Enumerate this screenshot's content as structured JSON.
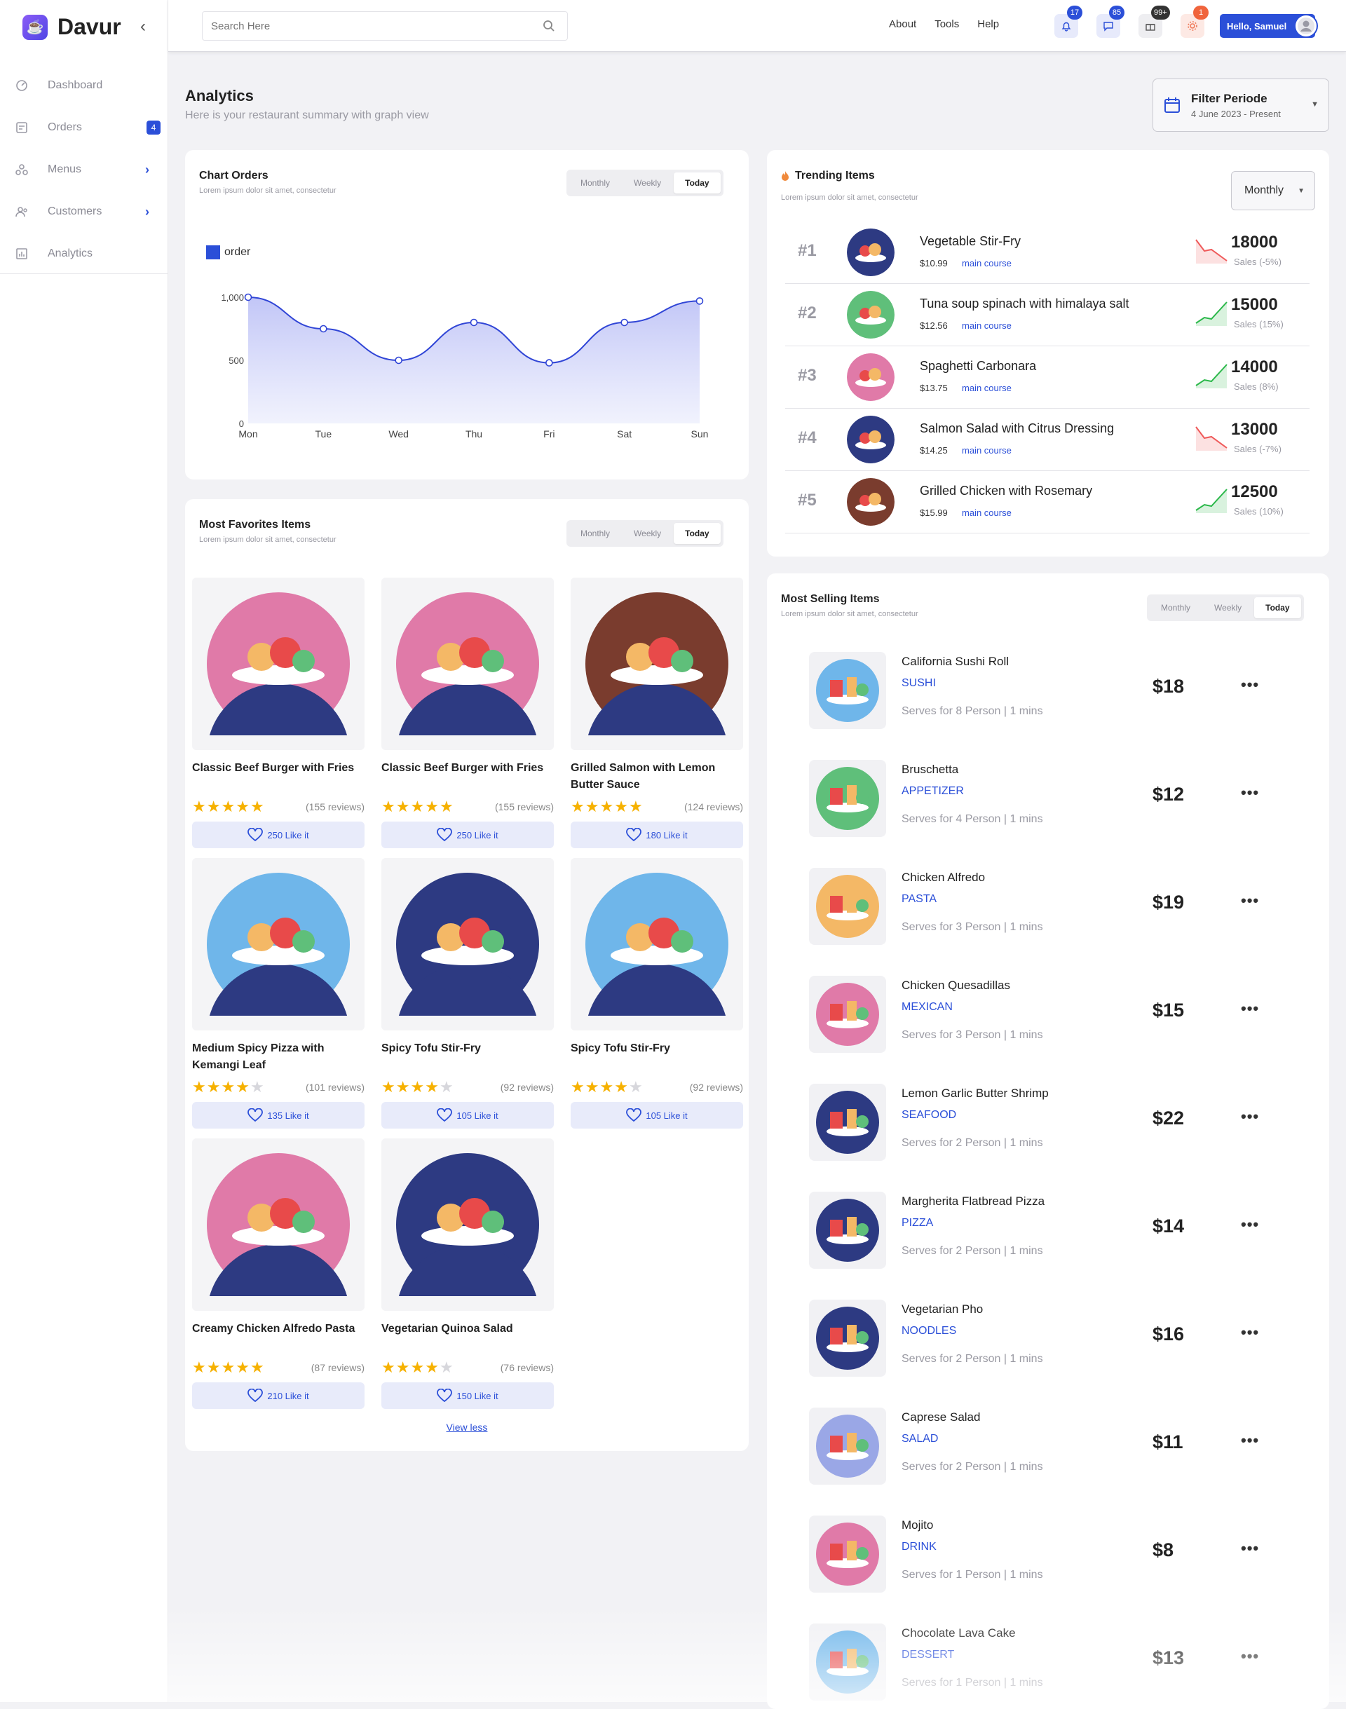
{
  "app": {
    "name": "Davur"
  },
  "sidebar": {
    "items": [
      {
        "label": "Dashboard",
        "icon": "dashboard-icon"
      },
      {
        "label": "Orders",
        "icon": "orders-icon",
        "badge": "4"
      },
      {
        "label": "Menus",
        "icon": "menus-icon"
      },
      {
        "label": "Customers",
        "icon": "customers-icon"
      },
      {
        "label": "Analytics",
        "icon": "analytics-icon"
      }
    ]
  },
  "topbar": {
    "search_placeholder": "Search Here",
    "nav": [
      "About",
      "Tools",
      "Help"
    ],
    "notifications": {
      "bell": "17",
      "chat": "85",
      "gift": "99+",
      "settings": "1"
    },
    "greeting": "Hello, Samuel"
  },
  "page": {
    "title": "Analytics",
    "subtitle": "Here is your restaurant summary with graph view"
  },
  "filter": {
    "title": "Filter Periode",
    "range": "4 June 2023 - Present"
  },
  "periods": [
    "Monthly",
    "Weekly",
    "Today"
  ],
  "chart_orders": {
    "title": "Chart Orders",
    "subtitle": "Lorem ipsum dolor sit amet, consectetur",
    "legend": "order"
  },
  "chart_data": {
    "type": "area",
    "categories": [
      "Mon",
      "Tue",
      "Wed",
      "Thu",
      "Fri",
      "Sat",
      "Sun"
    ],
    "series": [
      {
        "name": "order",
        "values": [
          1000,
          750,
          500,
          800,
          480,
          800,
          970
        ]
      }
    ],
    "yticks": [
      0,
      500,
      1000
    ],
    "ytick_labels": [
      "0",
      "500",
      "1,000"
    ],
    "ylim": [
      0,
      1000
    ],
    "title": "",
    "xlabel": "",
    "ylabel": "",
    "grid": false,
    "legend_position": "top-left",
    "color": "#3045d6"
  },
  "favorites": {
    "title": "Most Favorites Items",
    "subtitle": "Lorem ipsum dolor sit amet, consectetur",
    "view_less": "View less",
    "items": [
      {
        "name": "Classic Beef Burger with Fries",
        "rating": 5,
        "reviews": "(155 reviews)",
        "likes": "250 Like it",
        "bg": "#e07aa8"
      },
      {
        "name": "Classic Beef Burger with Fries",
        "rating": 5,
        "reviews": "(155 reviews)",
        "likes": "250 Like it",
        "bg": "#e07aa8"
      },
      {
        "name": "Grilled Salmon with Lemon Butter Sauce",
        "rating": 5,
        "reviews": "(124 reviews)",
        "likes": "180 Like it",
        "bg": "#7a3c2e"
      },
      {
        "name": "Medium Spicy Pizza with Kemangi Leaf",
        "rating": 4,
        "reviews": "(101 reviews)",
        "likes": "135 Like it",
        "bg": "#6fb6ea"
      },
      {
        "name": "Spicy Tofu Stir-Fry",
        "rating": 4,
        "reviews": "(92 reviews)",
        "likes": "105 Like it",
        "bg": "#2d3a82"
      },
      {
        "name": "Spicy Tofu Stir-Fry",
        "rating": 4,
        "reviews": "(92 reviews)",
        "likes": "105 Like it",
        "bg": "#6fb6ea"
      },
      {
        "name": "Creamy Chicken Alfredo Pasta",
        "rating": 5,
        "reviews": "(87 reviews)",
        "likes": "210 Like it",
        "bg": "#e07aa8"
      },
      {
        "name": "Vegetarian Quinoa Salad",
        "rating": 4,
        "reviews": "(76 reviews)",
        "likes": "150 Like it",
        "bg": "#2d3a82"
      }
    ]
  },
  "trending": {
    "title": "Trending Items",
    "subtitle": "Lorem ipsum dolor sit amet, consectetur",
    "select": "Monthly",
    "items": [
      {
        "rank": "#1",
        "name": "Vegetable Stir-Fry",
        "price": "$10.99",
        "category": "main course",
        "value": "18000",
        "sales": "Sales (-5%)",
        "trend": "down",
        "bg": "#2d3a82"
      },
      {
        "rank": "#2",
        "name": "Tuna soup spinach with himalaya salt",
        "price": "$12.56",
        "category": "main course",
        "value": "15000",
        "sales": "Sales (15%)",
        "trend": "up",
        "bg": "#5fbf7a"
      },
      {
        "rank": "#3",
        "name": "Spaghetti Carbonara",
        "price": "$13.75",
        "category": "main course",
        "value": "14000",
        "sales": "Sales (8%)",
        "trend": "up",
        "bg": "#e07aa8"
      },
      {
        "rank": "#4",
        "name": "Salmon Salad with Citrus Dressing",
        "price": "$14.25",
        "category": "main course",
        "value": "13000",
        "sales": "Sales (-7%)",
        "trend": "down",
        "bg": "#2d3a82"
      },
      {
        "rank": "#5",
        "name": "Grilled Chicken with Rosemary",
        "price": "$15.99",
        "category": "main course",
        "value": "12500",
        "sales": "Sales (10%)",
        "trend": "up",
        "bg": "#7a3c2e"
      }
    ]
  },
  "selling": {
    "title": "Most Selling Items",
    "subtitle": "Lorem ipsum dolor sit amet, consectetur",
    "items": [
      {
        "name": "California Sushi Roll",
        "category": "SUSHI",
        "serves": "Serves for 8 Person | 1 mins",
        "price": "$18",
        "bg": "#6fb6ea"
      },
      {
        "name": "Bruschetta",
        "category": "APPETIZER",
        "serves": "Serves for 4 Person | 1 mins",
        "price": "$12",
        "bg": "#5fbf7a"
      },
      {
        "name": "Chicken Alfredo",
        "category": "PASTA",
        "serves": "Serves for 3 Person | 1 mins",
        "price": "$19",
        "bg": "#f4b866"
      },
      {
        "name": "Chicken Quesadillas",
        "category": "MEXICAN",
        "serves": "Serves for 3 Person | 1 mins",
        "price": "$15",
        "bg": "#e07aa8"
      },
      {
        "name": "Lemon Garlic Butter Shrimp",
        "category": "SEAFOOD",
        "serves": "Serves for 2 Person | 1 mins",
        "price": "$22",
        "bg": "#2d3a82"
      },
      {
        "name": "Margherita Flatbread Pizza",
        "category": "PIZZA",
        "serves": "Serves for 2 Person | 1 mins",
        "price": "$14",
        "bg": "#2d3a82"
      },
      {
        "name": "Vegetarian Pho",
        "category": "NOODLES",
        "serves": "Serves for 2 Person | 1 mins",
        "price": "$16",
        "bg": "#2d3a82"
      },
      {
        "name": "Caprese Salad",
        "category": "SALAD",
        "serves": "Serves for 2 Person | 1 mins",
        "price": "$11",
        "bg": "#9aa7e6"
      },
      {
        "name": "Mojito",
        "category": "DRINK",
        "serves": "Serves for 1 Person | 1 mins",
        "price": "$8",
        "bg": "#e07aa8"
      },
      {
        "name": "Chocolate Lava Cake",
        "category": "DESSERT",
        "serves": "Serves for 1 Person | 1 mins",
        "price": "$13",
        "bg": "#6fb6ea"
      }
    ]
  }
}
